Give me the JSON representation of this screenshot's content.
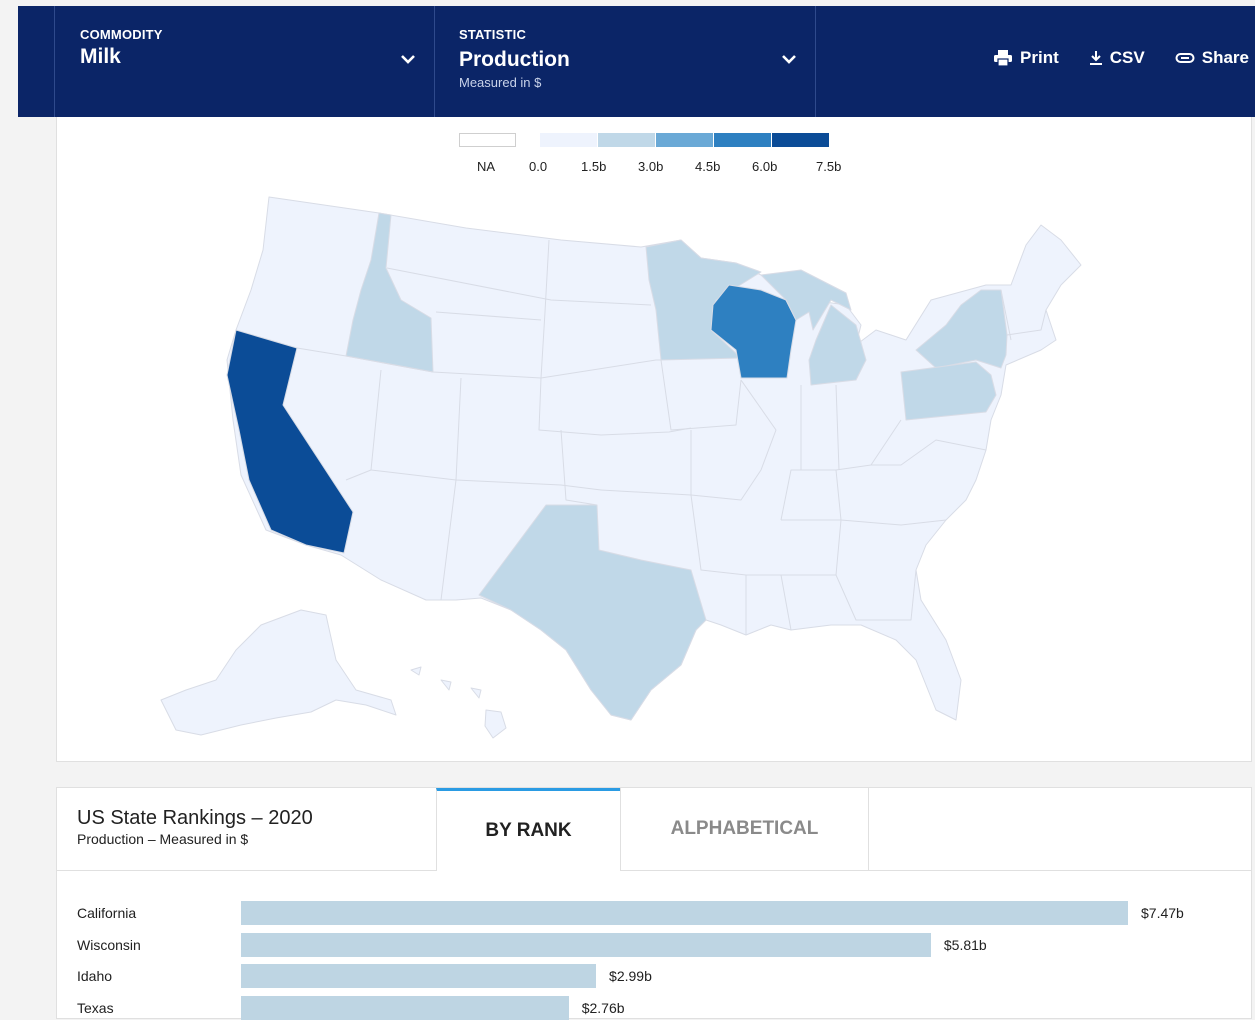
{
  "header": {
    "commodity": {
      "label": "COMMODITY",
      "value": "Milk"
    },
    "statistic": {
      "label": "STATISTIC",
      "value": "Production",
      "sub": "Measured in $"
    },
    "actions": {
      "print": "Print",
      "csv": "CSV",
      "share": "Share"
    }
  },
  "legend": {
    "na_label": "NA",
    "ticks": [
      "0.0",
      "1.5b",
      "3.0b",
      "4.5b",
      "6.0b",
      "7.5b"
    ],
    "colors": {
      "na": "#ffffff",
      "c1": "#eef3fd",
      "c2": "#c0d8e8",
      "c3": "#6aa9d6",
      "c4": "#2e80c1",
      "c5": "#0b4c97"
    }
  },
  "map": {
    "highlighted_states": [
      {
        "state": "California",
        "color": "#0b4c97"
      },
      {
        "state": "Wisconsin",
        "color": "#2e80c1"
      },
      {
        "state": "Idaho",
        "color": "#c0d8e8"
      },
      {
        "state": "Texas",
        "color": "#c0d8e8"
      },
      {
        "state": "Minnesota",
        "color": "#c0d8e8"
      },
      {
        "state": "Michigan",
        "color": "#c0d8e8"
      },
      {
        "state": "New York",
        "color": "#c0d8e8"
      },
      {
        "state": "Pennsylvania",
        "color": "#c0d8e8"
      }
    ],
    "base_color": "#eef3fd"
  },
  "rankings": {
    "title": "US State Rankings – 2020",
    "subtitle": "Production – Measured in $",
    "tabs": [
      "BY RANK",
      "ALPHABETICAL"
    ],
    "active_tab": "BY RANK",
    "max_value": 7.47,
    "rows": [
      {
        "state": "California",
        "value": 7.47,
        "label": "$7.47b"
      },
      {
        "state": "Wisconsin",
        "value": 5.81,
        "label": "$5.81b"
      },
      {
        "state": "Idaho",
        "value": 2.99,
        "label": "$2.99b"
      },
      {
        "state": "Texas",
        "value": 2.76,
        "label": "$2.76b"
      }
    ]
  }
}
